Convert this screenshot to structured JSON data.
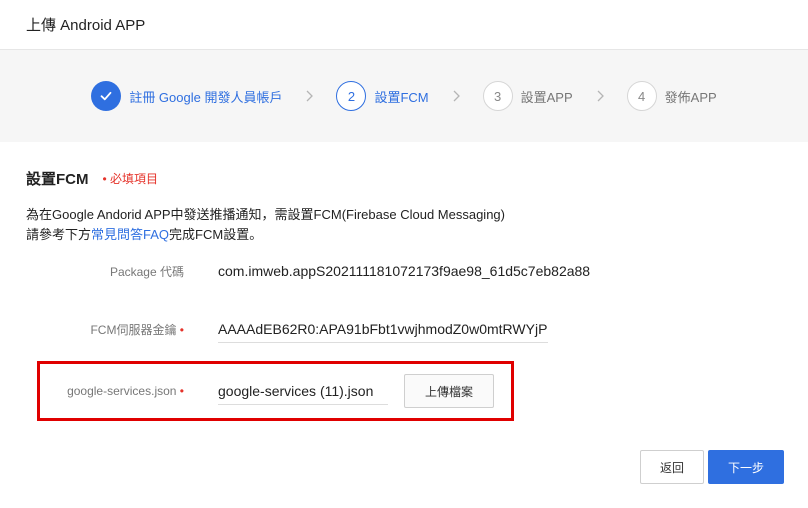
{
  "header": {
    "title": "上傳 Android APP"
  },
  "steps": [
    {
      "number": "",
      "label": "註冊 Google 開發人員帳戶",
      "state": "done"
    },
    {
      "number": "2",
      "label": "設置FCM",
      "state": "active"
    },
    {
      "number": "3",
      "label": "設置APP",
      "state": "todo"
    },
    {
      "number": "4",
      "label": "發佈APP",
      "state": "todo"
    }
  ],
  "section": {
    "title": "設置FCM",
    "required_label": "• 必填項目",
    "desc_line1": "為在Google Andorid APP中發送推播通知，需設置FCM(Firebase Cloud Messaging)",
    "desc_line2_prefix": "請參考下方",
    "desc_link": "常見問答FAQ",
    "desc_line2_suffix": "完成FCM設置。"
  },
  "fields": {
    "package_label": "Package 代碼",
    "package_value": "com.imweb.appS202111181072173f9ae98_61d5c7eb82a88",
    "fcm_key_label": "FCM伺服器金鑰",
    "fcm_key_value": "AAAAdEB62R0:APA91bFbt1vwjhmodZ0w0mtRWYjP",
    "gs_label": "google-services.json",
    "gs_value": "google-services (11).json",
    "upload_label": "上傳檔案",
    "required_dot": "•"
  },
  "buttons": {
    "back": "返回",
    "next": "下一步"
  },
  "colors": {
    "accent": "#2f6fe0",
    "required": "#e5332a",
    "highlight": "#e00000"
  }
}
